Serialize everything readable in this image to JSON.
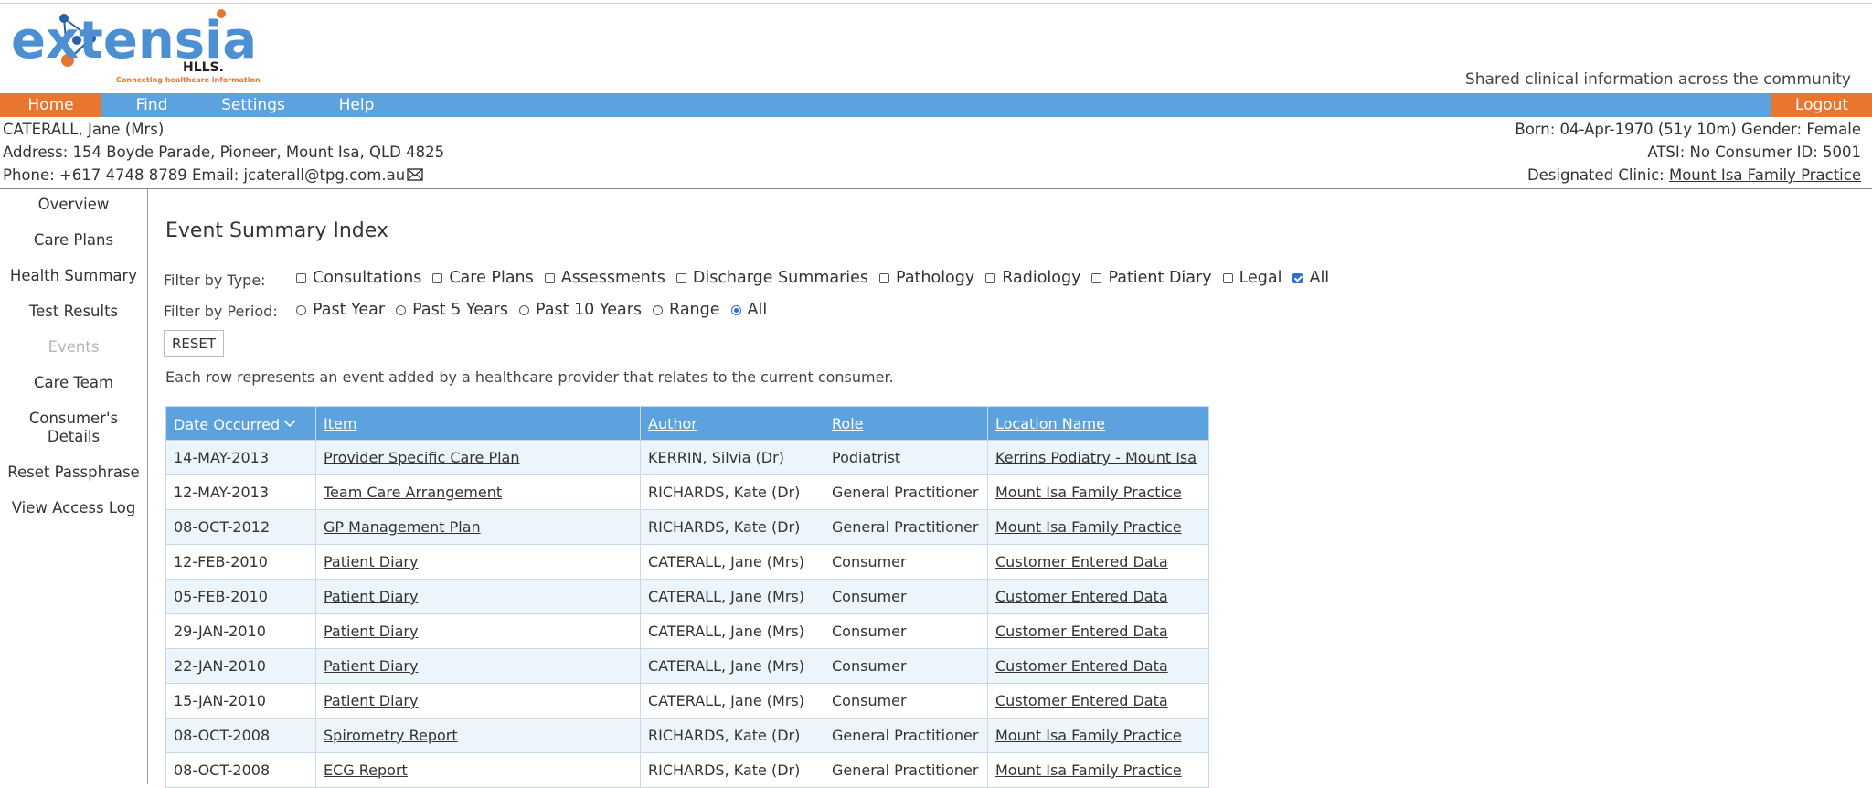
{
  "header": {
    "logo_text": "extensia",
    "logo_sub": "HLLS.",
    "logo_tagline": "Connecting healthcare information",
    "tagline": "Shared clinical information across the community"
  },
  "nav": {
    "home": "Home",
    "find": "Find",
    "settings": "Settings",
    "help": "Help",
    "logout": "Logout"
  },
  "patient": {
    "name": "CATERALL, Jane (Mrs)",
    "address": "Address: 154 Boyde Parade, Pioneer, Mount Isa, QLD 4825",
    "contact": "Phone: +617 4748 8789 Email: jcaterall@tpg.com.au",
    "born": "Born: 04-Apr-1970 (51y 10m) Gender: Female",
    "atsi": "ATSI: No Consumer ID: 5001",
    "clinic_label": "Designated Clinic:",
    "clinic": "Mount Isa Family Practice"
  },
  "sidebar": {
    "items": [
      {
        "label": "Overview"
      },
      {
        "label": "Care Plans"
      },
      {
        "label": "Health Summary"
      },
      {
        "label": "Test Results"
      },
      {
        "label": "Events"
      },
      {
        "label": "Care Team"
      },
      {
        "label": "Consumer's Details"
      },
      {
        "label": "Reset Passphrase"
      },
      {
        "label": "View Access Log"
      }
    ]
  },
  "main": {
    "title": "Event Summary Index",
    "filter_type_label": "Filter by Type:",
    "filter_period_label": "Filter by Period:",
    "type_options": [
      {
        "label": "Consultations",
        "checked": false
      },
      {
        "label": "Care Plans",
        "checked": false
      },
      {
        "label": "Assessments",
        "checked": false
      },
      {
        "label": "Discharge Summaries",
        "checked": false
      },
      {
        "label": "Pathology",
        "checked": false
      },
      {
        "label": "Radiology",
        "checked": false
      },
      {
        "label": "Patient Diary",
        "checked": false
      },
      {
        "label": "Legal",
        "checked": false
      },
      {
        "label": "All",
        "checked": true
      }
    ],
    "period_options": [
      {
        "label": "Past Year",
        "checked": false
      },
      {
        "label": "Past 5 Years",
        "checked": false
      },
      {
        "label": "Past 10 Years",
        "checked": false
      },
      {
        "label": "Range",
        "checked": false
      },
      {
        "label": "All",
        "checked": true
      }
    ],
    "reset_label": "RESET",
    "description": "Each row represents an event added by a healthcare provider that relates to the current consumer."
  },
  "table": {
    "headers": [
      "Date Occurred",
      "Item",
      "Author",
      "Role",
      "Location Name"
    ],
    "rows": [
      [
        "14-MAY-2013",
        "Provider Specific Care Plan",
        "KERRIN, Silvia (Dr)",
        "Podiatrist",
        "Kerrins Podiatry - Mount Isa"
      ],
      [
        "12-MAY-2013",
        "Team Care Arrangement",
        "RICHARDS, Kate (Dr)",
        "General Practitioner",
        "Mount Isa Family Practice"
      ],
      [
        "08-OCT-2012",
        "GP Management Plan",
        "RICHARDS, Kate (Dr)",
        "General Practitioner",
        "Mount Isa Family Practice"
      ],
      [
        "12-FEB-2010",
        "Patient Diary",
        "CATERALL, Jane (Mrs)",
        "Consumer",
        "Customer Entered Data"
      ],
      [
        "05-FEB-2010",
        "Patient Diary",
        "CATERALL, Jane (Mrs)",
        "Consumer",
        "Customer Entered Data"
      ],
      [
        "29-JAN-2010",
        "Patient Diary",
        "CATERALL, Jane (Mrs)",
        "Consumer",
        "Customer Entered Data"
      ],
      [
        "22-JAN-2010",
        "Patient Diary",
        "CATERALL, Jane (Mrs)",
        "Consumer",
        "Customer Entered Data"
      ],
      [
        "15-JAN-2010",
        "Patient Diary",
        "CATERALL, Jane (Mrs)",
        "Consumer",
        "Customer Entered Data"
      ],
      [
        "08-OCT-2008",
        "Spirometry Report",
        "RICHARDS, Kate (Dr)",
        "General Practitioner",
        "Mount Isa Family Practice"
      ],
      [
        "08-OCT-2008",
        "ECG Report",
        "RICHARDS, Kate (Dr)",
        "General Practitioner",
        "Mount Isa Family Practice"
      ]
    ]
  },
  "colors": {
    "nav_blue": "#5ba2de",
    "accent_orange": "#e9762e",
    "row_alt": "#ecf5fb",
    "checked_blue": "#2f6fd6"
  },
  "icons": {
    "email": "envelope-icon",
    "sort": "sort-descending-icon"
  }
}
